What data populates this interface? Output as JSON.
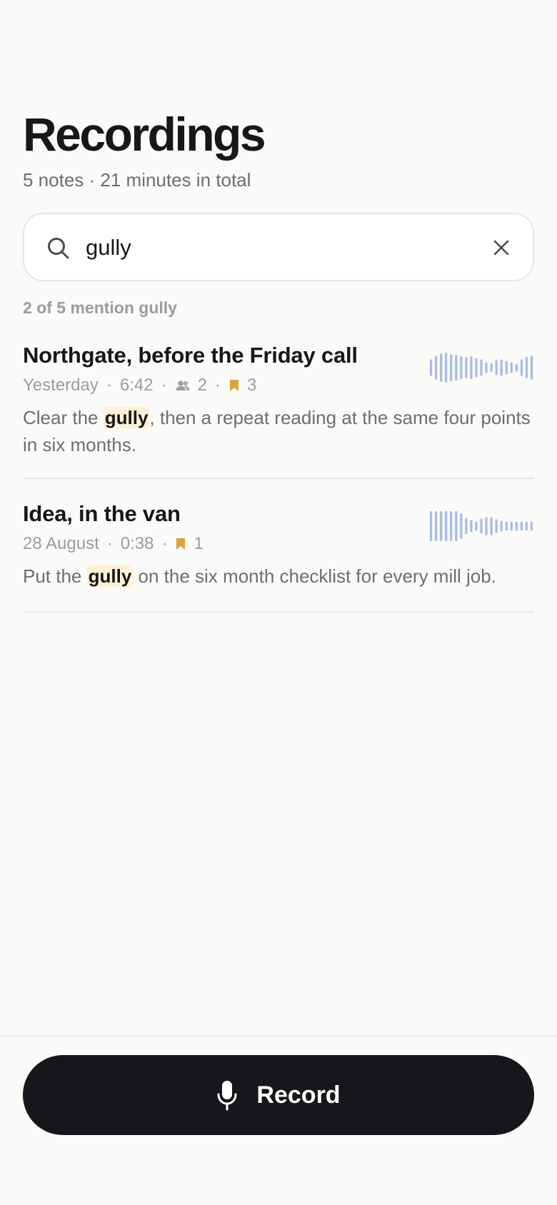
{
  "header": {
    "title": "Recordings",
    "subtitle": "5 notes · 21 minutes in total"
  },
  "search": {
    "query": "gully",
    "icon": "search-icon",
    "clear_icon": "close-icon"
  },
  "results": {
    "count_text": "2 of 5 mention gully"
  },
  "recordings": [
    {
      "title": "Northgate, before the Friday call",
      "date": "Yesterday",
      "duration": "6:42",
      "people_count": "2",
      "bookmark_count": "3",
      "excerpt_before": "Clear the ",
      "excerpt_match": "gully",
      "excerpt_after": ", then a repeat reading at the same four points in six months.",
      "waveform": [
        0.55,
        0.8,
        0.95,
        1.0,
        0.9,
        0.85,
        0.75,
        0.7,
        0.75,
        0.65,
        0.55,
        0.35,
        0.3,
        0.5,
        0.55,
        0.45,
        0.35,
        0.25,
        0.55,
        0.7,
        0.8
      ]
    },
    {
      "title": "Idea, in the van",
      "date": "28 August",
      "duration": "0:38",
      "bookmark_count": "1",
      "excerpt_before": "Put the ",
      "excerpt_match": "gully",
      "excerpt_after": " on the six month checklist for every mill job.",
      "waveform": [
        1.0,
        1.0,
        1.0,
        1.0,
        1.0,
        1.0,
        0.85,
        0.55,
        0.4,
        0.3,
        0.5,
        0.6,
        0.6,
        0.45,
        0.35,
        0.3,
        0.3,
        0.3,
        0.3,
        0.3,
        0.3
      ]
    }
  ],
  "record_button": {
    "label": "Record",
    "icon": "microphone-icon"
  },
  "colors": {
    "background": "#fafaf8",
    "text": "#16171a",
    "muted": "#6b6e73",
    "highlight": "#fdf1d6",
    "bookmark": "#d9a53b",
    "waveform": "#a7bbe6"
  }
}
